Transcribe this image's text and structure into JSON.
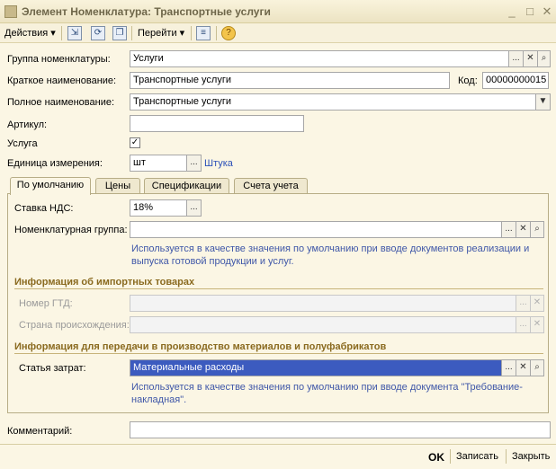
{
  "window": {
    "title": "Элемент Номенклатура: Транспортные услуги",
    "minimize": "_",
    "maximize": "□",
    "close": "✕"
  },
  "toolbar": {
    "actions": "Действия",
    "goto": "Перейти"
  },
  "form": {
    "group_label": "Группа номенклатуры:",
    "group_value": "Услуги",
    "short_label": "Краткое наименование:",
    "short_value": "Транспортные услуги",
    "code_label": "Код:",
    "code_value": "00000000015",
    "full_label": "Полное наименование:",
    "full_value": "Транспортные услуги",
    "article_label": "Артикул:",
    "article_value": "",
    "service_label": "Услуга",
    "service_checked": true,
    "unit_label": "Единица измерения:",
    "unit_value": "шт",
    "unit_link": "Штука",
    "comment_label": "Комментарий:",
    "comment_value": ""
  },
  "tabs": [
    "По умолчанию",
    "Цены",
    "Спецификации",
    "Счета учета"
  ],
  "default_tab": {
    "vat_label": "Ставка НДС:",
    "vat_value": "18%",
    "nomgroup_label": "Номенклатурная группа:",
    "nomgroup_value": "",
    "nomgroup_hint": "Используется в качестве значения по умолчанию при вводе документов  реализации и выпуска готовой продукции и услуг.",
    "import_section": "Информация об импортных товарах",
    "gtd_label": "Номер ГТД:",
    "gtd_value": "",
    "country_label": "Страна происхождения:",
    "country_value": "",
    "production_section": "Информация для передачи в производство материалов и полуфабрикатов",
    "cost_label": "Статья затрат:",
    "cost_value": "Материальные расходы",
    "cost_hint": "Используется в качестве значения по умолчанию при вводе документа \"Требование-накладная\"."
  },
  "footer": {
    "ok": "OK",
    "save": "Записать",
    "close": "Закрыть"
  },
  "icons": {
    "select": "...",
    "clear": "✕",
    "search": "🔍",
    "dropdown": "▼",
    "check": "✓",
    "help": "?"
  }
}
